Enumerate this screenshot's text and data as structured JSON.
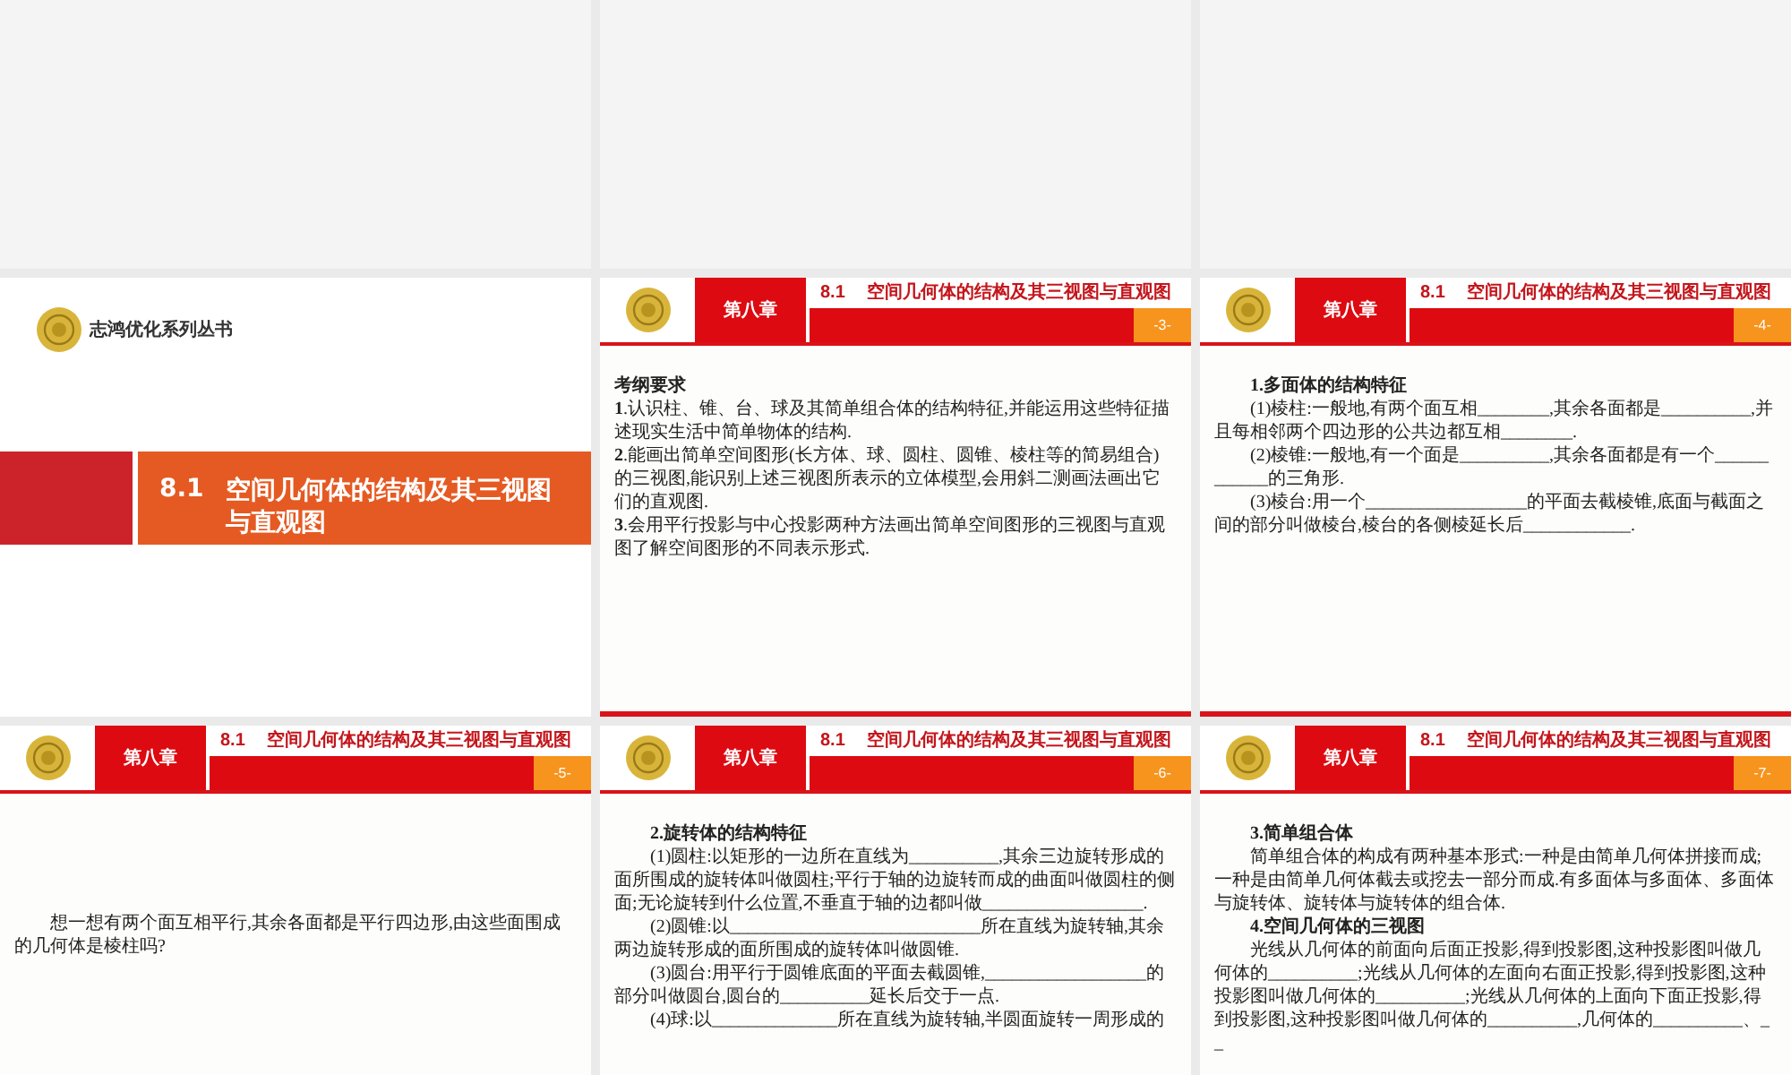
{
  "slides": [
    {
      "kind": "title",
      "brand": "志鸿优化系列丛书",
      "number": "8.1",
      "title": "空间几何体的结构及其三视图与直观图"
    },
    {
      "kind": "content",
      "chapter": "第八章",
      "section_number": "8.1",
      "section_title": "空间几何体的结构及其三视图与直观图",
      "page": "-3-",
      "paragraphs": [
        {
          "kind": "title",
          "text": "考纲要求"
        },
        {
          "kind": "plain",
          "text": "**1**.认识柱、锥、台、球及其简单组合体的结构特征,并能运用这些特征描述现实生活中简单物体的结构."
        },
        {
          "kind": "plain",
          "text": "**2**.能画出简单空间图形(长方体、球、圆柱、圆锥、棱柱等的简易组合)的三视图,能识别上述三视图所表示的立体模型,会用斜二测画法画出它们的直观图."
        },
        {
          "kind": "plain",
          "text": "**3**.会用平行投影与中心投影两种方法画出简单空间图形的三视图与直观图了解空间图形的不同表示形式."
        }
      ]
    },
    {
      "kind": "content",
      "chapter": "第八章",
      "section_number": "8.1",
      "section_title": "空间几何体的结构及其三视图与直观图",
      "page": "-4-",
      "paragraphs": [
        {
          "kind": "heading",
          "text": "1.多面体的结构特征"
        },
        {
          "kind": "text",
          "text": "(1)棱柱:一般地,有两个面互相________,其余各面都是__________,并且每相邻两个四边形的公共边都互相________."
        },
        {
          "kind": "text",
          "text": "(2)棱锥:一般地,有一个面是__________,其余各面都是有一个____________的三角形."
        },
        {
          "kind": "text",
          "text": "(3)棱台:用一个__________________的平面去截棱锥,底面与截面之间的部分叫做棱台,棱台的各侧棱延长后____________."
        }
      ]
    },
    {
      "kind": "content",
      "chapter": "第八章",
      "section_number": "8.1",
      "section_title": "空间几何体的结构及其三视图与直观图",
      "page": "-5-",
      "paragraphs": [
        {
          "kind": "spacer"
        },
        {
          "kind": "text",
          "text": "想一想有两个面互相平行,其余各面都是平行四边形,由这些面围成的几何体是棱柱吗?"
        }
      ]
    },
    {
      "kind": "content",
      "chapter": "第八章",
      "section_number": "8.1",
      "section_title": "空间几何体的结构及其三视图与直观图",
      "page": "-6-",
      "paragraphs": [
        {
          "kind": "heading",
          "text": "2.旋转体的结构特征"
        },
        {
          "kind": "text",
          "text": "(1)圆柱:以矩形的一边所在直线为__________,其余三边旋转形成的面所围成的旋转体叫做圆柱;平行于轴的边旋转而成的曲面叫做圆柱的侧面;无论旋转到什么位置,不垂直于轴的边都叫做__________________."
        },
        {
          "kind": "text",
          "text": "(2)圆锥:以____________________________所在直线为旋转轴,其余两边旋转形成的面所围成的旋转体叫做圆锥."
        },
        {
          "kind": "text",
          "text": "(3)圆台:用平行于圆锥底面的平面去截圆锥,__________________的部分叫做圆台,圆台的__________延长后交于一点."
        },
        {
          "kind": "text",
          "text": "(4)球:以______________所在直线为旋转轴,半圆面旋转一周形成的"
        }
      ]
    },
    {
      "kind": "content",
      "chapter": "第八章",
      "section_number": "8.1",
      "section_title": "空间几何体的结构及其三视图与直观图",
      "page": "-7-",
      "paragraphs": [
        {
          "kind": "heading",
          "text": "3.简单组合体"
        },
        {
          "kind": "text",
          "text": "简单组合体的构成有两种基本形式:一种是由简单几何体拼接而成;一种是由简单几何体截去或挖去一部分而成.有多面体与多面体、多面体与旋转体、旋转体与旋转体的组合体."
        },
        {
          "kind": "heading",
          "text": "4.空间几何体的三视图"
        },
        {
          "kind": "text",
          "text": "光线从几何体的前面向后面正投影,得到投影图,这种投影图叫做几何体的__________;光线从几何体的左面向右面正投影,得到投影图,这种投影图叫做几何体的__________;光线从几何体的上面向下面正投影,得到投影图,这种投影图叫做几何体的__________,几何体的__________、__"
        }
      ]
    }
  ]
}
